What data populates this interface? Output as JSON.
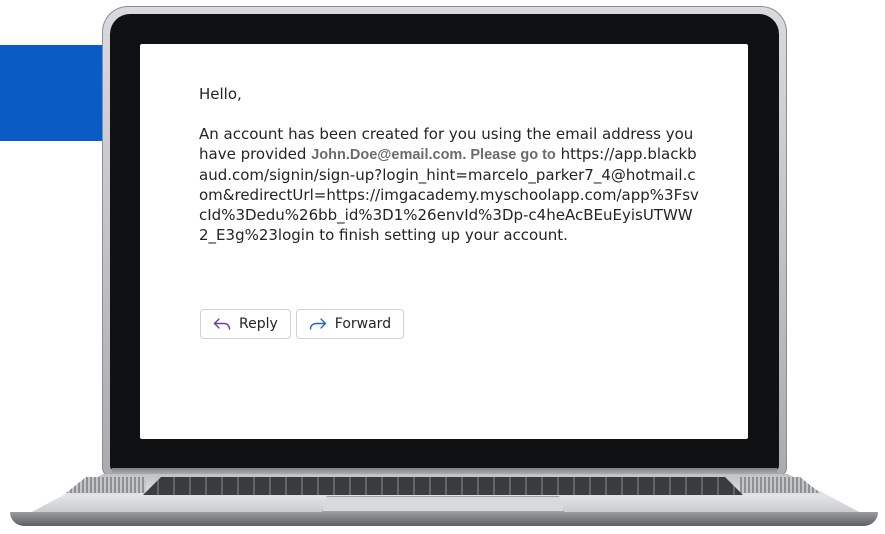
{
  "email": {
    "greeting": "Hello,",
    "body_before": "An account has been created for you using the email address you have provided ",
    "provided_address": "John.Doe@email.com. Please go to",
    "body_after": " https://app.blackbaud.com/signin/sign-up?login_hint=marcelo_parker7_4@hotmail.com&redirectUrl=https://imgacademy.myschoolapp.com/app%3FsvcId%3Dedu%26bb_id%3D1%26envId%3Dp-c4heAcBEuEyisUTWW2_E3g%23login to finish setting up your account."
  },
  "actions": {
    "reply_label": "Reply",
    "forward_label": "Forward"
  },
  "icons": {
    "reply": "reply-arrow-icon",
    "forward": "forward-arrow-icon"
  },
  "colors": {
    "accent_blue": "#0a5bc4",
    "icon_purple": "#6b3fa0",
    "icon_blue": "#2266cc"
  }
}
